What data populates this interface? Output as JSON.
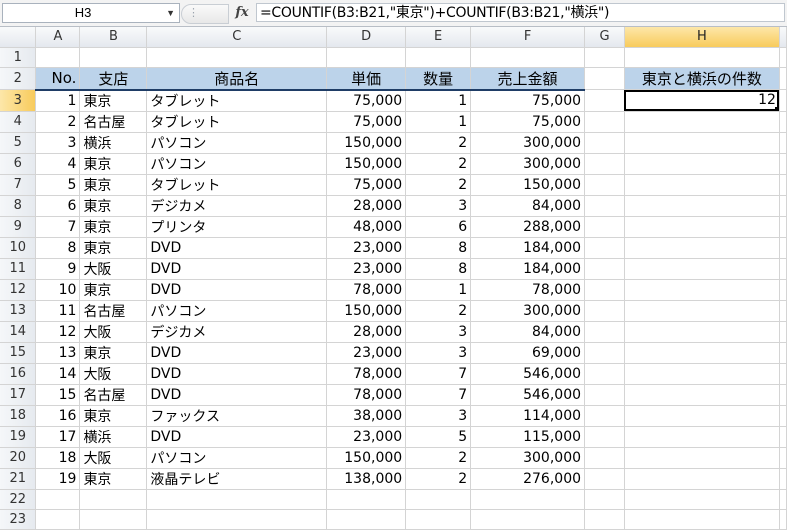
{
  "formula_bar": {
    "name_box": "H3",
    "fx_label": "fx",
    "formula": "=COUNTIF(B3:B21,\"東京\")+COUNTIF(B3:B21,\"横浜\")"
  },
  "columns": [
    "A",
    "B",
    "C",
    "D",
    "E",
    "F",
    "G",
    "H"
  ],
  "header": {
    "no": "No.",
    "branch": "支店",
    "product": "商品名",
    "price": "単価",
    "qty": "数量",
    "sales": "売上金額",
    "result_title": "東京と横浜の件数"
  },
  "result_value": "12",
  "rows": [
    {
      "r": "3",
      "no": "1",
      "branch": "東京",
      "product": "タブレット",
      "price": "75,000",
      "qty": "1",
      "sales": "75,000"
    },
    {
      "r": "4",
      "no": "2",
      "branch": "名古屋",
      "product": "タブレット",
      "price": "75,000",
      "qty": "1",
      "sales": "75,000"
    },
    {
      "r": "5",
      "no": "3",
      "branch": "横浜",
      "product": "パソコン",
      "price": "150,000",
      "qty": "2",
      "sales": "300,000"
    },
    {
      "r": "6",
      "no": "4",
      "branch": "東京",
      "product": "パソコン",
      "price": "150,000",
      "qty": "2",
      "sales": "300,000"
    },
    {
      "r": "7",
      "no": "5",
      "branch": "東京",
      "product": "タブレット",
      "price": "75,000",
      "qty": "2",
      "sales": "150,000"
    },
    {
      "r": "8",
      "no": "6",
      "branch": "東京",
      "product": "デジカメ",
      "price": "28,000",
      "qty": "3",
      "sales": "84,000"
    },
    {
      "r": "9",
      "no": "7",
      "branch": "東京",
      "product": "プリンタ",
      "price": "48,000",
      "qty": "6",
      "sales": "288,000"
    },
    {
      "r": "10",
      "no": "8",
      "branch": "東京",
      "product": "DVD",
      "price": "23,000",
      "qty": "8",
      "sales": "184,000"
    },
    {
      "r": "11",
      "no": "9",
      "branch": "大阪",
      "product": "DVD",
      "price": "23,000",
      "qty": "8",
      "sales": "184,000"
    },
    {
      "r": "12",
      "no": "10",
      "branch": "東京",
      "product": "DVD",
      "price": "78,000",
      "qty": "1",
      "sales": "78,000"
    },
    {
      "r": "13",
      "no": "11",
      "branch": "名古屋",
      "product": "パソコン",
      "price": "150,000",
      "qty": "2",
      "sales": "300,000"
    },
    {
      "r": "14",
      "no": "12",
      "branch": "大阪",
      "product": "デジカメ",
      "price": "28,000",
      "qty": "3",
      "sales": "84,000"
    },
    {
      "r": "15",
      "no": "13",
      "branch": "東京",
      "product": "DVD",
      "price": "23,000",
      "qty": "3",
      "sales": "69,000"
    },
    {
      "r": "16",
      "no": "14",
      "branch": "大阪",
      "product": "DVD",
      "price": "78,000",
      "qty": "7",
      "sales": "546,000"
    },
    {
      "r": "17",
      "no": "15",
      "branch": "名古屋",
      "product": "DVD",
      "price": "78,000",
      "qty": "7",
      "sales": "546,000"
    },
    {
      "r": "18",
      "no": "16",
      "branch": "東京",
      "product": "ファックス",
      "price": "38,000",
      "qty": "3",
      "sales": "114,000"
    },
    {
      "r": "19",
      "no": "17",
      "branch": "横浜",
      "product": "DVD",
      "price": "23,000",
      "qty": "5",
      "sales": "115,000"
    },
    {
      "r": "20",
      "no": "18",
      "branch": "大阪",
      "product": "パソコン",
      "price": "150,000",
      "qty": "2",
      "sales": "300,000"
    },
    {
      "r": "21",
      "no": "19",
      "branch": "東京",
      "product": "液晶テレビ",
      "price": "138,000",
      "qty": "2",
      "sales": "276,000"
    }
  ],
  "extra_row_labels": [
    "1",
    "2",
    "22",
    "23"
  ]
}
